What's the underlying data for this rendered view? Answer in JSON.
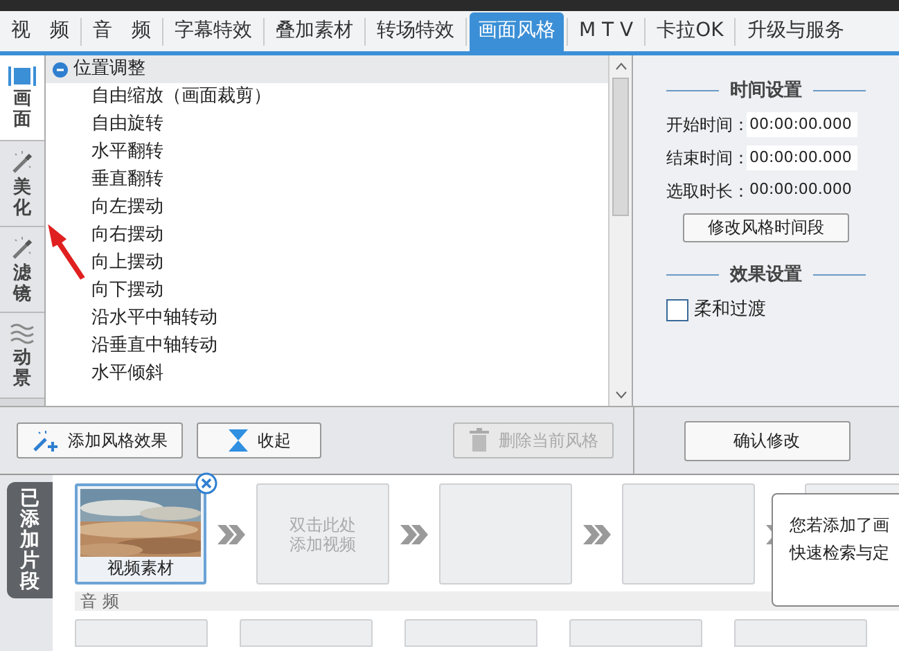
{
  "top_tabs": [
    {
      "label": "视　频",
      "selected": false
    },
    {
      "label": "音　频",
      "selected": false
    },
    {
      "label": "字幕特效",
      "selected": false
    },
    {
      "label": "叠加素材",
      "selected": false
    },
    {
      "label": "转场特效",
      "selected": false
    },
    {
      "label": "画面风格",
      "selected": true
    },
    {
      "label": "M T V",
      "selected": false
    },
    {
      "label": "卡拉OK",
      "selected": false
    },
    {
      "label": "升级与服务",
      "selected": false
    }
  ],
  "side_tabs": [
    {
      "label": "画面",
      "kind": "film",
      "selected": true
    },
    {
      "label": "美化",
      "kind": "wand",
      "selected": false
    },
    {
      "label": "滤镜",
      "kind": "wand",
      "selected": false
    },
    {
      "label": "动景",
      "kind": "waves",
      "selected": false
    }
  ],
  "effect_list": {
    "group": "位置调整",
    "expanded": true,
    "items": [
      "自由缩放（画面裁剪）",
      "自由旋转",
      "水平翻转",
      "垂直翻转",
      "向左摆动",
      "向右摆动",
      "向上摆动",
      "向下摆动",
      "沿水平中轴转动",
      "沿垂直中轴转动",
      "水平倾斜"
    ]
  },
  "time_settings": {
    "title": "时间设置",
    "start_label": "开始时间：",
    "start_value": "00:00:00.000",
    "end_label": "结束时间：",
    "end_value": "00:00:00.000",
    "duration_label": "选取时长：",
    "duration_value": "00:00:00.000",
    "button": "修改风格时间段"
  },
  "effect_settings": {
    "title": "效果设置",
    "checkbox": {
      "label": "柔和过渡",
      "checked": false
    }
  },
  "toolbar": [
    {
      "kind": "add",
      "label": "添加风格效果",
      "disabled": false
    },
    {
      "kind": "collapse",
      "label": "收起",
      "disabled": false
    },
    {
      "kind": "delete",
      "label": "删除当前风格",
      "disabled": true
    }
  ],
  "confirm_button": "确认修改",
  "clips_label": "已添加片段",
  "clips": [
    {
      "kind": "video",
      "caption": "视频素材"
    },
    {
      "kind": "empty",
      "hint": [
        "双击此处",
        "添加视频"
      ]
    },
    {
      "kind": "empty"
    },
    {
      "kind": "empty"
    },
    {
      "kind": "empty"
    }
  ],
  "audio_label": "音 频",
  "tooltip": [
    "您若添加了画",
    "快速检索与定"
  ]
}
